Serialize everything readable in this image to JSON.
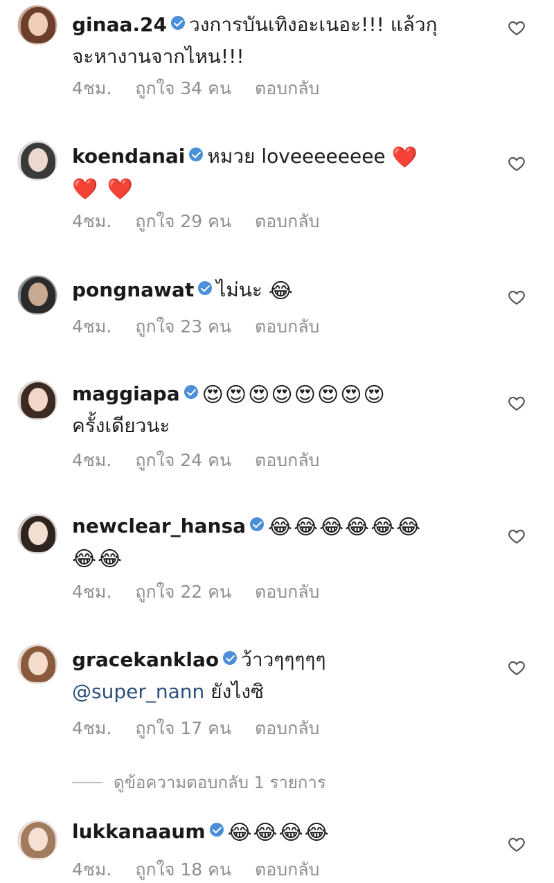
{
  "comments": [
    {
      "username": "ginaa.24",
      "text": "วงการบันเทิงอะเนอะ!!! แล้วกุ",
      "text2": "จะหางานจากไหน!!!",
      "time": "4ชม.",
      "likes": "ถูกใจ 34 คน",
      "reply": "ตอบกลับ"
    },
    {
      "username": "koendanai",
      "text": "หมวย loveeeeeeee",
      "emoji1": "❤️",
      "emoji2": "❤️ ❤️",
      "time": "4ชม.",
      "likes": "ถูกใจ 29 คน",
      "reply": "ตอบกลับ"
    },
    {
      "username": "pongnawat",
      "text": "ไม่นะ",
      "emoji1": "😂",
      "time": "4ชม.",
      "likes": "ถูกใจ 23 คน",
      "reply": "ตอบกลับ"
    },
    {
      "username": "maggiapa",
      "emoji1": "😍😍😍😍😍😍😍😍",
      "text2": "ครั้งเดียวนะ",
      "time": "4ชม.",
      "likes": "ถูกใจ 24 คน",
      "reply": "ตอบกลับ"
    },
    {
      "username": "newclear_hansa",
      "emoji1": "😂😂😂😂😂😂",
      "emoji2": "😂😂",
      "time": "4ชม.",
      "likes": "ถูกใจ 22 คน",
      "reply": "ตอบกลับ"
    },
    {
      "username": "gracekanklao",
      "text": "ว้าวๆๆๆๆๆ",
      "mention": "@super_nann",
      "text2": "ยังไงซิ",
      "time": "4ชม.",
      "likes": "ถูกใจ 17 คน",
      "reply": "ตอบกลับ"
    },
    {
      "username": "lukkanaaum",
      "emoji1": "😂😂😂😂",
      "time": "4ชม.",
      "likes": "ถูกใจ 18 คน",
      "reply": "ตอบกลับ"
    }
  ],
  "view_replies": "ดูข้อความตอบกลับ 1 รายการ",
  "icons": {
    "like": "heart-outline-icon",
    "verified": "verified-badge-icon"
  },
  "colors": {
    "verified": "#4a8fd8",
    "meta": "#8e8e8e",
    "mention": "#2a4f7a"
  }
}
